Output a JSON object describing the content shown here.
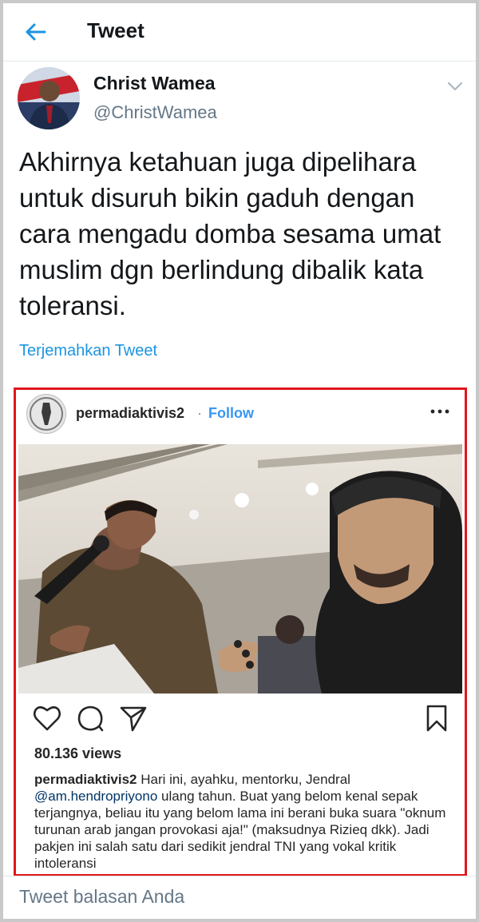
{
  "header": {
    "title": "Tweet"
  },
  "author": {
    "name": "Christ Wamea",
    "handle": "@ChristWamea"
  },
  "tweet": {
    "text": "Akhirnya ketahuan juga dipelihara untuk disuruh bikin gaduh dengan cara mengadu domba sesama umat muslim dgn berlindung dibalik kata toleransi.",
    "translate_label": "Terjemahkan Tweet"
  },
  "instagram": {
    "username": "permadiaktivis2",
    "separator": "·",
    "follow_label": "Follow",
    "views": "80.136 views",
    "caption_user": "permadiaktivis2",
    "caption_part1": "Hari ini, ayahku, mentorku, Jendral",
    "caption_mention": "@am.hendropriyono",
    "caption_part2": "ulang tahun. Buat yang belom kenal sepak terjangnya, beliau itu yang belom lama ini berani buka suara \"oknum turunan arab jangan provokasi aja!\" (maksudnya Rizieq dkk). Jadi pakjen ini salah satu dari sedikit jendral TNI yang vokal kritik intoleransi"
  },
  "reply": {
    "placeholder": "Tweet balasan Anda"
  },
  "colors": {
    "accent": "#1b95e0",
    "highlight_border": "#e0161c",
    "ig_link": "#3897f0"
  }
}
